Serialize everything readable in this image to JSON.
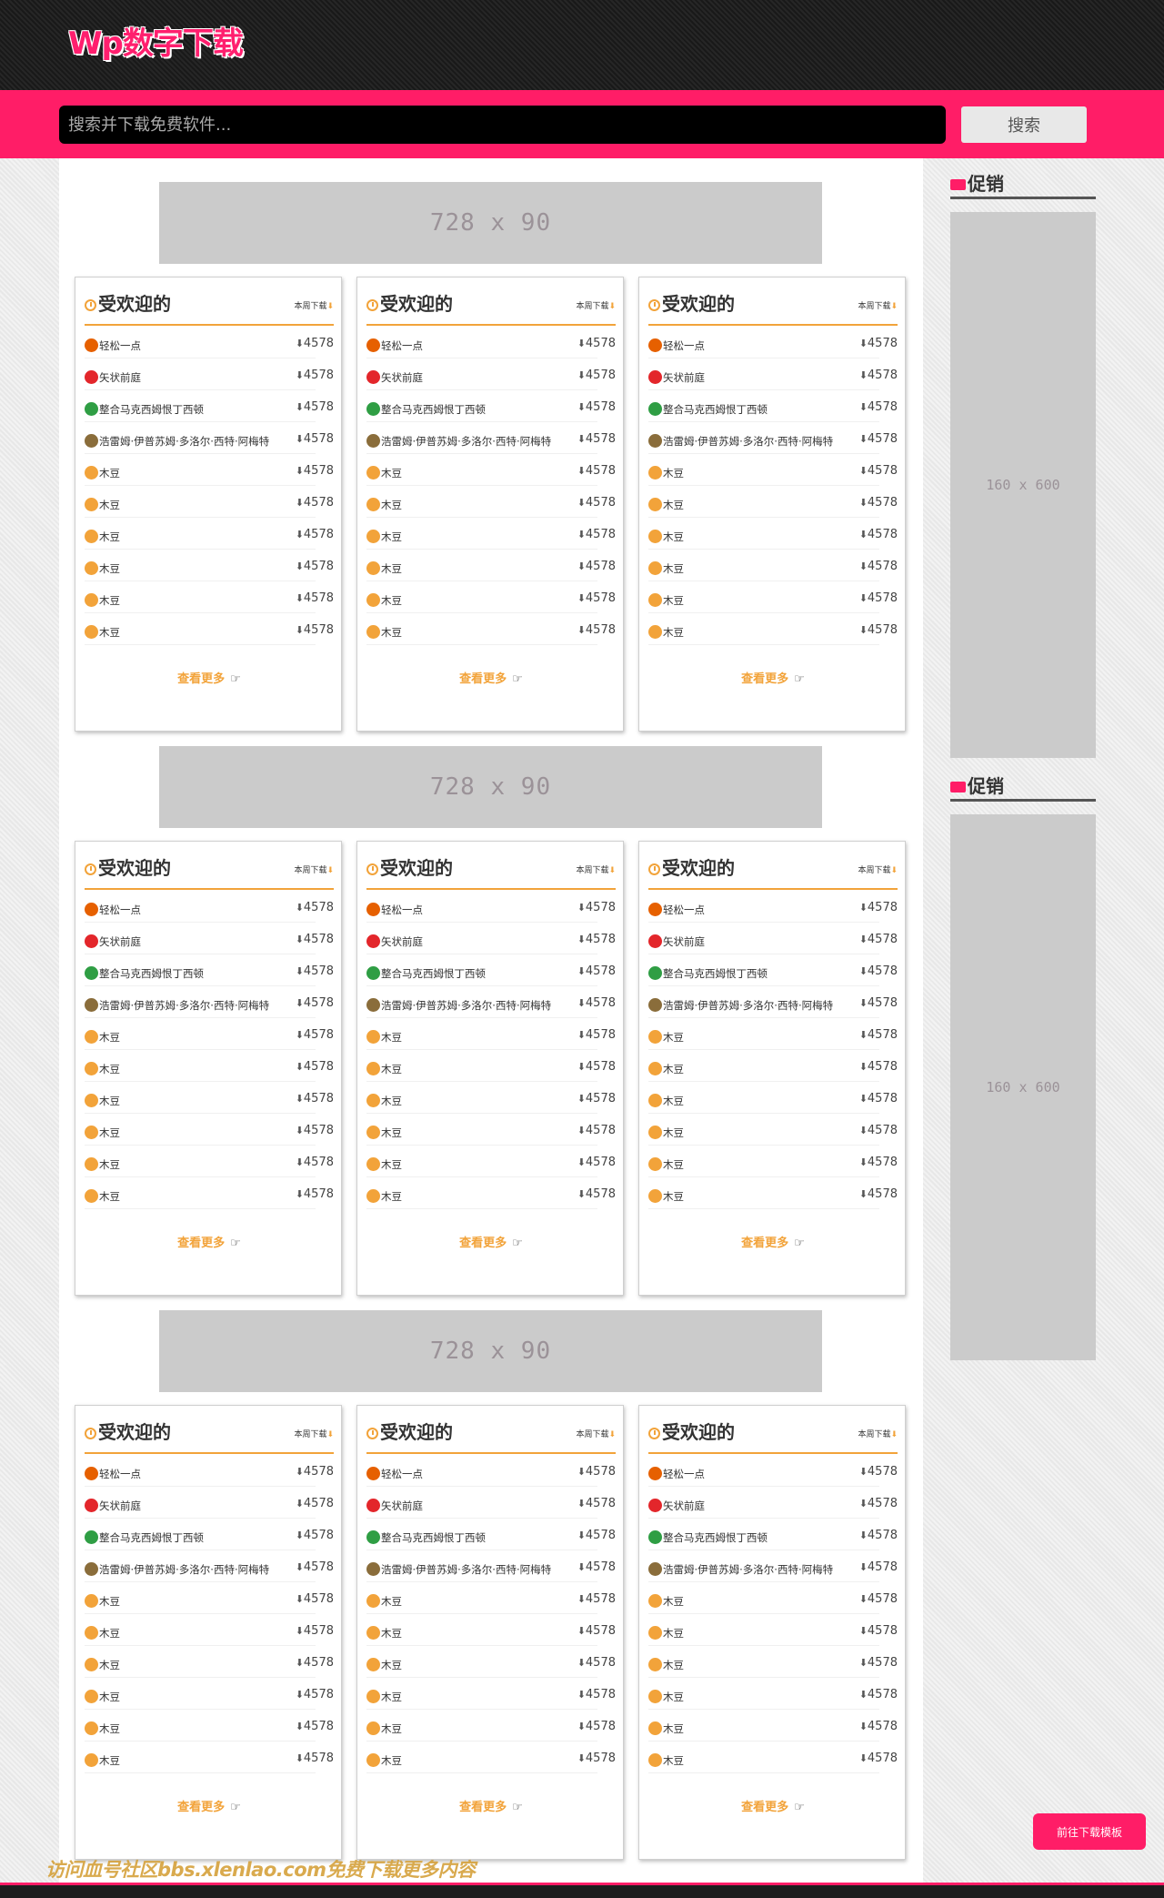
{
  "header": {
    "logo_part1": "Wp数字",
    "logo_part2": "下载"
  },
  "search": {
    "placeholder": "搜索并下载免费软件...",
    "button_label": "搜索"
  },
  "ads": {
    "banner_label": "728 x 90",
    "side_label": "160 x 600"
  },
  "card": {
    "title": "受欢迎的",
    "week_label": "本周下载",
    "more_label": "查看更多",
    "items": [
      {
        "name": "轻松一点",
        "count": "4578",
        "icon": "firefox-icon",
        "color": "#e66000"
      },
      {
        "name": "矢状前庭",
        "count": "4578",
        "icon": "pdf-icon",
        "color": "#e3262b"
      },
      {
        "name": "整合马克西姆恨丁西顿",
        "count": "4578",
        "icon": "chrome-icon",
        "color": "#2f9e44"
      },
      {
        "name": "浩雷姆·伊普苏姆·多洛尔·西特·阿梅特",
        "count": "4578",
        "icon": "feather-icon",
        "color": "#8a6d3b"
      },
      {
        "name": "木豆",
        "count": "4578",
        "icon": "star-icon",
        "color": "#f2a33a"
      },
      {
        "name": "木豆",
        "count": "4578",
        "icon": "star-icon",
        "color": "#f2a33a"
      },
      {
        "name": "木豆",
        "count": "4578",
        "icon": "star-icon",
        "color": "#f2a33a"
      },
      {
        "name": "木豆",
        "count": "4578",
        "icon": "star-icon",
        "color": "#f2a33a"
      },
      {
        "name": "木豆",
        "count": "4578",
        "icon": "star-icon",
        "color": "#f2a33a"
      },
      {
        "name": "木豆",
        "count": "4578",
        "icon": "star-icon",
        "color": "#f2a33a"
      }
    ]
  },
  "sidebar": {
    "section_title": "促销"
  },
  "goto_button": "前往下载模板",
  "watermark": "访问血号社区bbs.xlenlao.com免费下载更多内容",
  "colors": {
    "accent": "#ff1d67",
    "orange": "#f2a33a"
  }
}
